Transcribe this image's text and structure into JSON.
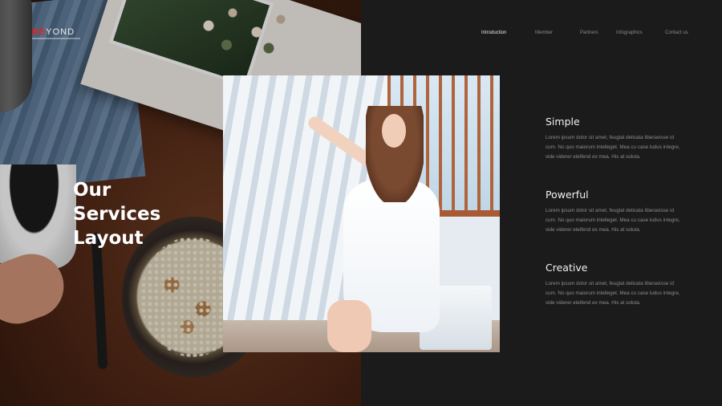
{
  "logo": {
    "accent": "BE",
    "rest": "YOND"
  },
  "nav": {
    "items": [
      "Introduction",
      "Member",
      "Partners",
      "Infographics",
      "Contact us"
    ],
    "active_index": 0
  },
  "title": {
    "line1": "Our",
    "line2": "Services",
    "line3": "Layout"
  },
  "services": [
    {
      "title": "Simple",
      "body": "Lorem ipsum dolor sit amet, feugiat delicata liberavisse id cum. No quo maiorum intelleget. Mea cu case ludus integre, vide viderer eleifend ex mea. His at soluta."
    },
    {
      "title": "Powerful",
      "body": "Lorem ipsum dolor sit amet, feugiat delicata liberavisse id cum. No quo maiorum intelleget. Mea cu case ludus integre, vide viderer eleifend ex mea. His at soluta."
    },
    {
      "title": "Creative",
      "body": "Lorem ipsum dolor sit amet, feugiat delicata liberavisse id cum. No quo maiorum intelleget. Mea cu case ludus integre, vide viderer eleifend ex mea. His at soluta."
    }
  ],
  "colors": {
    "background": "#1b1b1b",
    "accent": "#e02424",
    "nav_active": "#e6e6e6",
    "nav_inactive": "#8a8a8a",
    "service_title": "#f2f2f2",
    "service_body": "#8c8c8c"
  },
  "images": {
    "left": "breakfast-table-photo",
    "center": "woman-by-window-photo"
  }
}
